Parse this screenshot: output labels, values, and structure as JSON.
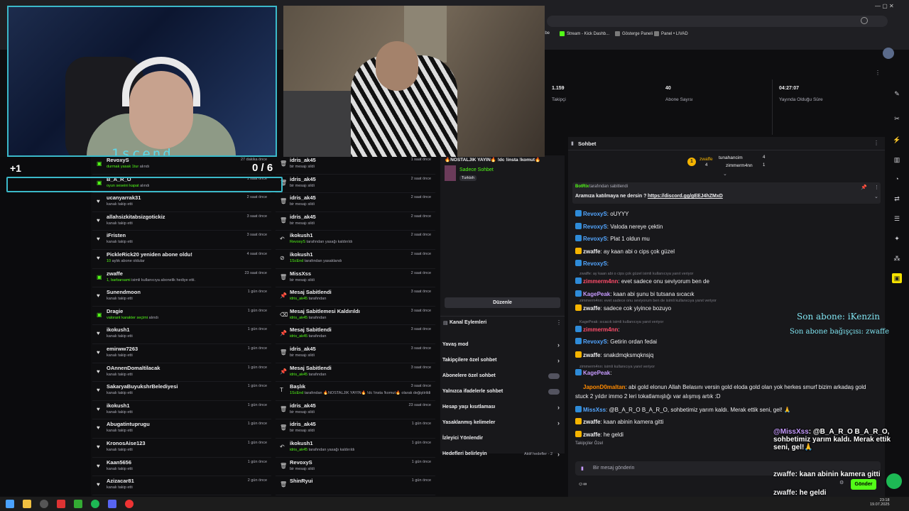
{
  "browser": {
    "bookmarks": [
      "ube",
      "Stream - Kick Dashb...",
      "Gösterge Paneli",
      "Panel • LIVAD"
    ]
  },
  "overlay": {
    "cam_label": "1scend",
    "plus": "+1",
    "counter": "0 / 6",
    "last_sub": "Son abone: iKenzin",
    "last_gift": "Son abone bağışçısı: zwaffe"
  },
  "feedA": [
    {
      "name": "RevoxyS",
      "sub": "durmak yasak 1tur",
      "sub2": "alındı",
      "time": "27 dakika önce",
      "icon": "gift"
    },
    {
      "name": "B_A_R_O",
      "sub": "oyun seseini kapat",
      "sub2": "alındı",
      "time": "1 saat önce",
      "icon": "gift"
    },
    {
      "name": "ucanyarrak31",
      "sub": "kanalı takip etti",
      "sub2": "",
      "time": "2 saat önce",
      "icon": "heart"
    },
    {
      "name": "allahsizkitabsizgotickiz",
      "sub": "kanalı takip etti",
      "sub2": "",
      "time": "3 saat önce",
      "icon": "heart"
    },
    {
      "name": "iFristen",
      "sub": "kanalı takip etti",
      "sub2": "",
      "time": "3 saat önce",
      "icon": "heart"
    },
    {
      "name": "PickleRick20 yeniden abone oldu!",
      "sub": "10",
      "sub2": "aylık abone oldular",
      "time": "4 saat önce",
      "icon": "heart"
    },
    {
      "name": "zwaffe",
      "sub": "1, barbarsami",
      "sub2": "isimli kullanıcıya abonelik hediye etti.",
      "time": "23 saat önce",
      "icon": "gift"
    },
    {
      "name": "Sunendmoon",
      "sub": "kanalı takip etti",
      "sub2": "",
      "time": "1 gün önce",
      "icon": "heart"
    },
    {
      "name": "Dragie",
      "sub": "valorant karakter seçimi",
      "sub2": "alındı",
      "time": "1 gün önce",
      "icon": "gift"
    },
    {
      "name": "ikokush1",
      "sub": "kanalı takip etti",
      "sub2": "",
      "time": "1 gün önce",
      "icon": "heart"
    },
    {
      "name": "emirww7263",
      "sub": "kanalı takip etti",
      "sub2": "",
      "time": "1 gün önce",
      "icon": "heart"
    },
    {
      "name": "OAnnenDomaltilacak",
      "sub": "kanalı takip etti",
      "sub2": "",
      "time": "1 gün önce",
      "icon": "heart"
    },
    {
      "name": "SakaryaBuyukshrBelediyesi",
      "sub": "kanalı takip etti",
      "sub2": "",
      "time": "1 gün önce",
      "icon": "heart"
    },
    {
      "name": "ikokush1",
      "sub": "kanalı takip etti",
      "sub2": "",
      "time": "1 gün önce",
      "icon": "heart"
    },
    {
      "name": "Abugatintuprugu",
      "sub": "kanalı takip etti",
      "sub2": "",
      "time": "1 gün önce",
      "icon": "heart"
    },
    {
      "name": "KronosAise123",
      "sub": "kanalı takip etti",
      "sub2": "",
      "time": "1 gün önce",
      "icon": "heart"
    },
    {
      "name": "Kaan5656",
      "sub": "kanalı takip etti",
      "sub2": "",
      "time": "1 gün önce",
      "icon": "heart"
    },
    {
      "name": "Azizacar81",
      "sub": "kanalı takip etti",
      "sub2": "",
      "time": "2 gün önce",
      "icon": "heart"
    }
  ],
  "feedB": [
    {
      "name": "idris_ak45",
      "sub": "bir mesajı sildi",
      "sub2": "",
      "time": "1 saat önce",
      "icon": "trash"
    },
    {
      "name": "idris_ak45",
      "sub": "bir mesajı sildi",
      "sub2": "",
      "time": "2 saat önce",
      "icon": "trash"
    },
    {
      "name": "idris_ak45",
      "sub": "bir mesajı sildi",
      "sub2": "",
      "time": "2 saat önce",
      "icon": "trash"
    },
    {
      "name": "idris_ak45",
      "sub": "bir mesajı sildi",
      "sub2": "",
      "time": "2 saat önce",
      "icon": "trash"
    },
    {
      "name": "ikokush1",
      "sub": "RevoxyS",
      "sub2": "tarafından yasağı kaldırıldı",
      "time": "2 saat önce",
      "icon": "undo"
    },
    {
      "name": "ikokush1",
      "sub": "1ScEnd",
      "sub2": "tarafından yasaklandı",
      "time": "2 saat önce",
      "icon": "ban"
    },
    {
      "name": "MissXss",
      "sub": "bir mesajı sildi",
      "sub2": "",
      "time": "2 saat önce",
      "icon": "trash"
    },
    {
      "name": "Mesaj Sabitlendi",
      "sub": "idris_ak45",
      "sub2": "tarafından",
      "time": "3 saat önce",
      "icon": "pin"
    },
    {
      "name": "Mesaj Sabitlemesi Kaldırıldı",
      "sub": "idris_ak45",
      "sub2": "tarafından",
      "time": "3 saat önce",
      "icon": "unpin"
    },
    {
      "name": "Mesaj Sabitlendi",
      "sub": "idris_ak45",
      "sub2": "tarafından",
      "time": "3 saat önce",
      "icon": "pin"
    },
    {
      "name": "idris_ak45",
      "sub": "bir mesajı sildi",
      "sub2": "",
      "time": "3 saat önce",
      "icon": "trash"
    },
    {
      "name": "Mesaj Sabitlendi",
      "sub": "idris_ak45",
      "sub2": "tarafından",
      "time": "3 saat önce",
      "icon": "pin"
    },
    {
      "name": "Başlık",
      "sub": "1ScEnd",
      "sub2": "tarafından 🔥NOSTALJIK YAYIN🔥 !dc !insta !komut🔥 olarak değiştirildi",
      "time": "3 saat önce",
      "icon": "title"
    },
    {
      "name": "idris_ak45",
      "sub": "bir mesajı sildi",
      "sub2": "",
      "time": "23 saat önce",
      "icon": "trash"
    },
    {
      "name": "idris_ak45",
      "sub": "bir mesajı sildi",
      "sub2": "",
      "time": "1 gün önce",
      "icon": "trash"
    },
    {
      "name": "ikokush1",
      "sub": "idris_ak45",
      "sub2": "tarafından yasağı kaldırıldı",
      "time": "1 gün önce",
      "icon": "undo"
    },
    {
      "name": "RevoxyS",
      "sub": "bir mesajı sildi",
      "sub2": "",
      "time": "1 gün önce",
      "icon": "trash"
    },
    {
      "name": "ShinRyui",
      "sub": "",
      "sub2": "",
      "time": "1 gün önce",
      "icon": "trash"
    }
  ],
  "streaminfo": {
    "title": "🔥NOSTALJIK YAYIN🔥 !dc !insta !komut🔥",
    "category": "Sadece Sohbet",
    "language": "Turkish",
    "edit_button": "Düzenle",
    "actions_title": "Kanal Eylemleri",
    "actions": [
      "Yavaş mod",
      "Takipçilere özel sohbet",
      "Abonelere özel sohbet",
      "Yalnızca ifadelerle sohbet",
      "Hesap yaşı kısıtlaması",
      "Yasaklanmış kelimeler",
      "İzleyici Yönlendir",
      "Hedefleri belirleyin"
    ],
    "goals_status": "Aktif hedefler - 2"
  },
  "stats": {
    "followers": "1.159",
    "followers_label": "Takipçi",
    "subs": "40",
    "subs_label": "Abone Sayısı",
    "uptime": "04:27:07",
    "uptime_label": "Yayında Olduğu Süre"
  },
  "chat": {
    "title": "Sohbet",
    "leader1_name": "zwaffe",
    "leader1_count": "4",
    "leader2_name": "tunahancim",
    "leader2_count": "4",
    "leader3_name": "zimmerm4nn",
    "leader3_count": "1",
    "pinned_by": "BotRix",
    "pinned_by_suffix": "tarafından sabitlendi",
    "pinned_text": "Aramıza katılmaya ne dersin ?",
    "pinned_link": "https://discord.gg/gEEJ4hZMxD",
    "messages": [
      {
        "user": "RevoxyS",
        "text": "oUYYY",
        "color": "#53a6ff"
      },
      {
        "user": "RevoxyS",
        "text": "Valoda nereye çektin",
        "color": "#53a6ff"
      },
      {
        "user": "RevoxyS",
        "text": "Plat 1 oldun mu",
        "color": "#53a6ff"
      },
      {
        "user": "zwaffe",
        "text": "ay kaan abi o cips çok güzel",
        "color": "#efeff1"
      },
      {
        "user": "RevoxyS",
        "text": "",
        "color": "#53a6ff"
      },
      {
        "user": "zimmerm4nn",
        "text": "evet sadece onu seviyorum ben de",
        "color": "#ff4d6a"
      },
      {
        "user": "KagePeak",
        "text": "kaan abi şunu bi tutsana    sıcacık",
        "color": "#c79bff"
      },
      {
        "user": "zwaffe",
        "text": "sadece cok yiyince bozuyo",
        "color": "#efeff1"
      },
      {
        "user": "zimmerm4nn",
        "text": "",
        "color": "#ff4d6a"
      },
      {
        "user": "RevoxyS",
        "text": "Getirin ordan fedai",
        "color": "#53a6ff"
      },
      {
        "user": "zwaffe",
        "text": "snakdmqksmqknsjq",
        "color": "#efeff1"
      },
      {
        "user": "KagePeak",
        "text": "",
        "color": "#c79bff"
      },
      {
        "user": "JaponD0maltan",
        "text": "abi gold elonun Allah Belasını versin gold eloda gold olan yok herkes smurf bizim arkadaş gold",
        "color": "#ff8a00"
      },
      {
        "user": "",
        "text": "stuck 2 yıldır immo 2 leri tokatlamışlığı var alışmış artık :D",
        "color": "#efeff1"
      },
      {
        "user": "MissXss",
        "text": "@B_A_R_O B_A_R_O, sohbetimiz yarım kaldı. Merak ettik seni, gel! 🙏",
        "color": "#53a6ff"
      },
      {
        "user": "zwaffe",
        "text": "kaan abinin kamera gitti",
        "color": "#efeff1"
      },
      {
        "user": "zwaffe",
        "text": "he geldi",
        "color": "#efeff1"
      }
    ],
    "replies": [
      "zwaffe: ay kaan abi o cips çok güzel isimli kullanıcıya yanıt veriyor",
      "zimmerm4nn: evet sadece onu seviyorum ben de isimli kullanıcıya yanıt veriyor",
      "KagePeak: sıcacık isimli kullanıcıya yanıt veriyor",
      "zimmerm4nn: isimli kullanıcıya yanıt veriyor"
    ],
    "followers_only": "Takipçiler Özel",
    "input_placeholder": "Bir mesaj gönderin",
    "send_button": "Gönder"
  },
  "overlay_chat": [
    {
      "user": "@MissXss",
      "text": ": @B_A_R_O B_A_R_O, sohbetimiz yarım kaldı. Merak ettik seni, gel!🙏"
    },
    {
      "user": "zwaffe",
      "text": ": kaan abinin kamera gitti"
    },
    {
      "user": "zwaffe",
      "text": ": he geldi"
    }
  ],
  "taskbar": {
    "time": "23:18",
    "date": "19.07.2025"
  },
  "colors": {
    "accent": "#53fc18",
    "cam_border": "#3bb9c9",
    "panel": "#18181b"
  }
}
